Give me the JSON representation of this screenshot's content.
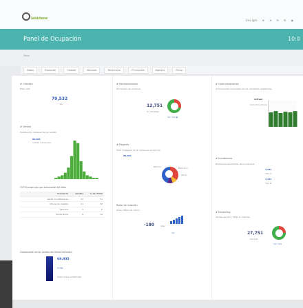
{
  "header": {
    "logo_text": "labidene",
    "nav": [
      "Una lgrn",
      "★",
      "⊕",
      "✉",
      "⚙",
      "◉"
    ],
    "title": "Panel de Ocupación",
    "title_right": "10:0"
  },
  "breadcrumb": "Panel",
  "tabs": [
    "Datos",
    "Evolución",
    "Calidad",
    "Mercado",
    "Tendencias",
    "Principales",
    "Agentes",
    "Reinp"
  ],
  "col1": {
    "w1": {
      "title": "# Clientes",
      "sub": "Total neto",
      "value": "79,532",
      "note": "ftp"
    },
    "w2": {
      "title": "# Ventas",
      "sub": "Distribución mensual de las ventas",
      "legend_top": "80,000",
      "legend_sub": "ventas mensuales"
    },
    "w3": {
      "title": "TOP 6 provincias con facturación del Neto",
      "headers": [
        "Provincia",
        "Ventas",
        "% del Total"
      ],
      "rows": [
        [
          "Santa Cruz/Baleares",
          "22",
          "51"
        ],
        [
          "Murcia de Castilla",
          "11",
          "30"
        ],
        [
          "Valencia",
          "5",
          "6"
        ],
        [
          "Santa María",
          "6",
          "14"
        ]
      ]
    },
    "w4": {
      "title": "Composición de las ventas del último semestre",
      "value1": "69,935",
      "value2": "2,701",
      "foot": "Costo sobre el Mercado"
    }
  },
  "col2": {
    "w1": {
      "title": "# Reclamaciones",
      "sub": "Porcentaje de reclamos",
      "value": "12,751",
      "value_note": "% resueltas",
      "link": "Ver más ▶"
    },
    "w2": {
      "title": "# Pagarés",
      "sub": "Total impagado de la cartera en el período",
      "value": "80,000",
      "legend_items": [
        "Bancos",
        "Bancos 2",
        "Otros"
      ]
    },
    "w3": {
      "title": "Ratio de rotación",
      "sub": "(Días / Plazo de cobro)",
      "value": "-180",
      "value_note": "días",
      "link": "Ver"
    }
  },
  "col3": {
    "w1": {
      "title": "# Comunicaciones",
      "sub": "Comunicados mensuales de las campañas registradas",
      "legend_a": "Activas",
      "legend_b": "Comunicaciones"
    },
    "w2": {
      "title": "# Incidencias",
      "sub": "Revisiones pendientes de los equipos",
      "value1": "3,637",
      "value1_note": "Tipo A",
      "value2": "3,531",
      "value2_note": "Tipo B"
    },
    "w3": {
      "title": "# Resolving",
      "sub": "Ventas del año / Total en Clientes",
      "value": "27,751",
      "value_note": "Sin Q.R.",
      "link": "Ver más"
    }
  },
  "chart_hist": {
    "type": "bar",
    "values": [
      1,
      2,
      3,
      5,
      9,
      18,
      30,
      28,
      14,
      6,
      3,
      2,
      1,
      1
    ],
    "color": "#4cad3d"
  },
  "chart_green": {
    "type": "bar",
    "values": [
      22,
      24,
      21,
      23,
      22,
      24
    ],
    "color": "#2f7d2d"
  },
  "colors": {
    "accent": "#4cb3ae",
    "donut_red": "#e0463b",
    "donut_green": "#3fae49"
  }
}
